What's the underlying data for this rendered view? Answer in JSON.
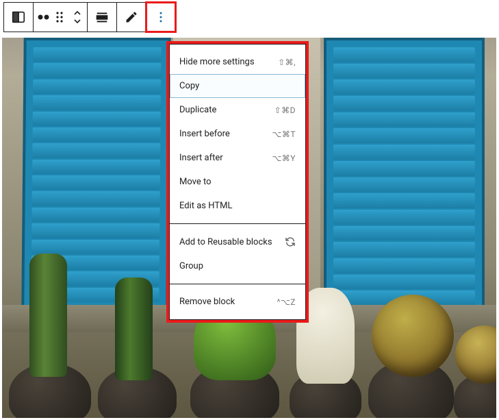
{
  "toolbar": {
    "icons": {
      "block_type": "layout-half-icon",
      "change_align": "dots-align-icon",
      "drag": "drag-handle-icon",
      "move": "move-updown-icon",
      "align": "align-full-icon",
      "edit": "pencil-icon",
      "more": "more-vertical-icon"
    }
  },
  "dropdown": {
    "sections": [
      {
        "items": [
          {
            "label": "Hide more settings",
            "shortcut": "⇧⌘,"
          },
          {
            "label": "Copy",
            "shortcut": "",
            "selected": true
          },
          {
            "label": "Duplicate",
            "shortcut": "⇧⌘D"
          },
          {
            "label": "Insert before",
            "shortcut": "⌥⌘T"
          },
          {
            "label": "Insert after",
            "shortcut": "⌥⌘Y"
          },
          {
            "label": "Move to",
            "shortcut": ""
          },
          {
            "label": "Edit as HTML",
            "shortcut": ""
          }
        ]
      },
      {
        "items": [
          {
            "label": "Add to Reusable blocks",
            "shortcut": "",
            "icon": "refresh-icon"
          },
          {
            "label": "Group",
            "shortcut": ""
          }
        ]
      },
      {
        "items": [
          {
            "label": "Remove block",
            "shortcut": "^⌥Z"
          }
        ]
      }
    ]
  }
}
